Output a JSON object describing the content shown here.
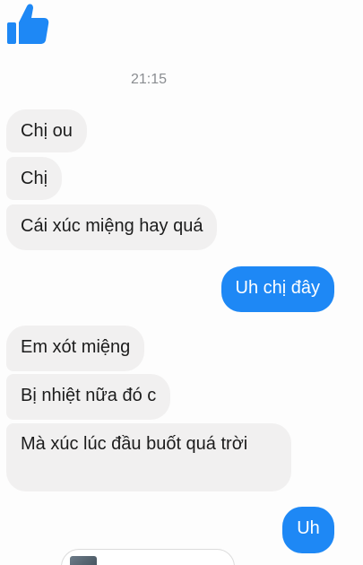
{
  "thread": {
    "like_icon": "thumbs-up-icon",
    "accent_color": "#1e88f5",
    "timestamp": "21:15",
    "messages": [
      {
        "from": "them",
        "text": "Chị ou"
      },
      {
        "from": "them",
        "text": "Chị"
      },
      {
        "from": "them",
        "text": "Cái xúc miệng hay quá"
      },
      {
        "from": "me",
        "text": "Uh chị đây"
      },
      {
        "from": "them",
        "text": "Em xót miệng"
      },
      {
        "from": "them",
        "text": "Bị nhiệt nữa đó c"
      },
      {
        "from": "them",
        "text": "Mà xúc lúc đầu buốt quá trời"
      },
      {
        "from": "me",
        "text": "Uh"
      }
    ]
  }
}
